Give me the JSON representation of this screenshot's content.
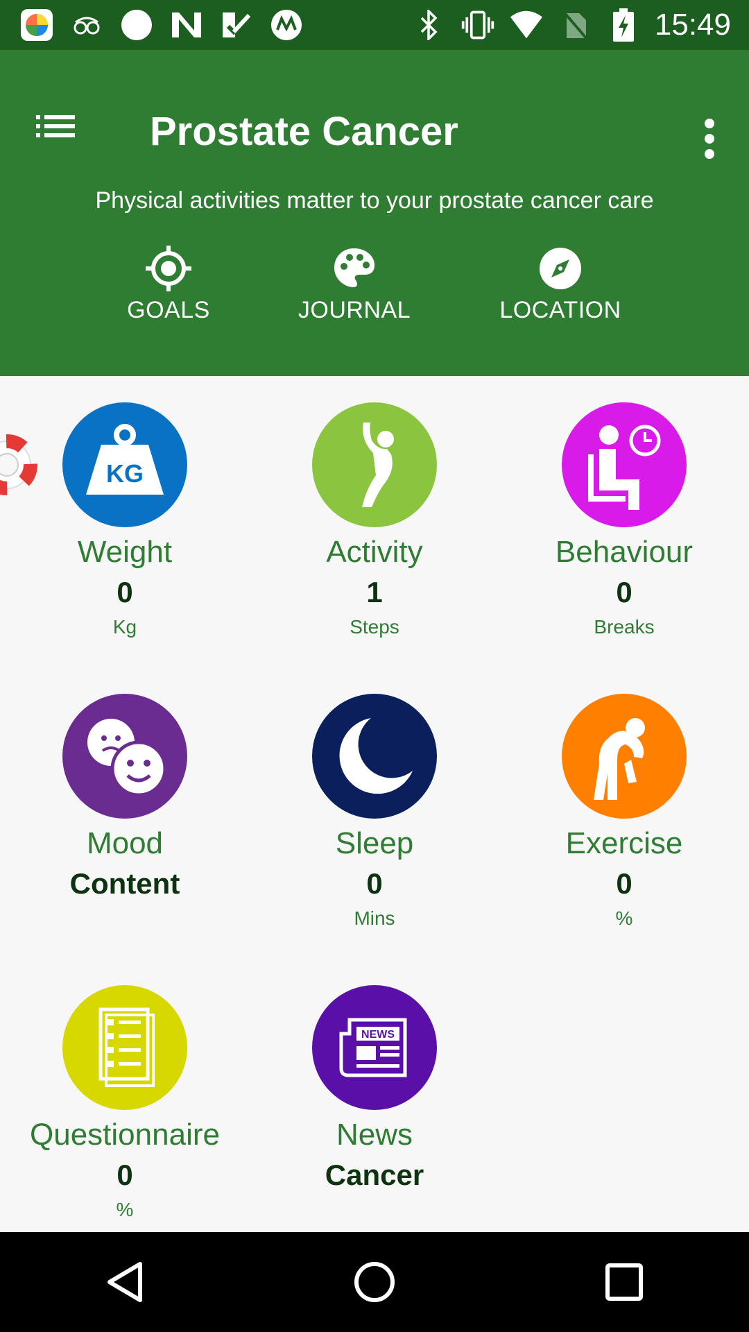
{
  "status_bar": {
    "time": "15:49",
    "left_icons": [
      "app-icon",
      "glasses-icon",
      "circle-icon",
      "n-icon",
      "check-icon",
      "m-icon"
    ],
    "right_icons": [
      "bluetooth-icon",
      "vibrate-icon",
      "wifi-icon",
      "no-sim-icon",
      "battery-charging-icon"
    ]
  },
  "app_bar": {
    "title": "Prostate Cancer",
    "subtitle": "Physical activities matter to your prostate cancer care",
    "shortcuts": [
      {
        "label": "GOALS",
        "icon": "target-icon"
      },
      {
        "label": "JOURNAL",
        "icon": "palette-icon"
      },
      {
        "label": "LOCATION",
        "icon": "compass-icon"
      }
    ],
    "colors": {
      "status": "#1b5e20",
      "bar": "#2f7d32"
    }
  },
  "tiles": [
    {
      "name": "Weight",
      "value": "0",
      "unit": "Kg",
      "icon": "kg-weight-icon",
      "color": "#0a72c4"
    },
    {
      "name": "Activity",
      "value": "1",
      "unit": "Steps",
      "icon": "activity-person-icon",
      "color": "#8bc53f"
    },
    {
      "name": "Behaviour",
      "value": "0",
      "unit": "Breaks",
      "icon": "sitting-clock-icon",
      "color": "#d81be8"
    },
    {
      "name": "Mood",
      "value": "Content",
      "unit": "",
      "icon": "mood-faces-icon",
      "color": "#6a2c91"
    },
    {
      "name": "Sleep",
      "value": "0",
      "unit": "Mins",
      "icon": "moon-icon",
      "color": "#0a1f5c"
    },
    {
      "name": "Exercise",
      "value": "0",
      "unit": "%",
      "icon": "stretch-person-icon",
      "color": "#ff7f00"
    },
    {
      "name": "Questionnaire",
      "value": "0",
      "unit": "%",
      "icon": "checklist-icon",
      "color": "#d7d800"
    },
    {
      "name": "News",
      "value": "Cancer",
      "unit": "",
      "icon": "news-icon",
      "color": "#5a0fa8"
    }
  ],
  "nav_bar": {
    "buttons": [
      "back-icon",
      "home-icon",
      "recents-icon"
    ]
  }
}
